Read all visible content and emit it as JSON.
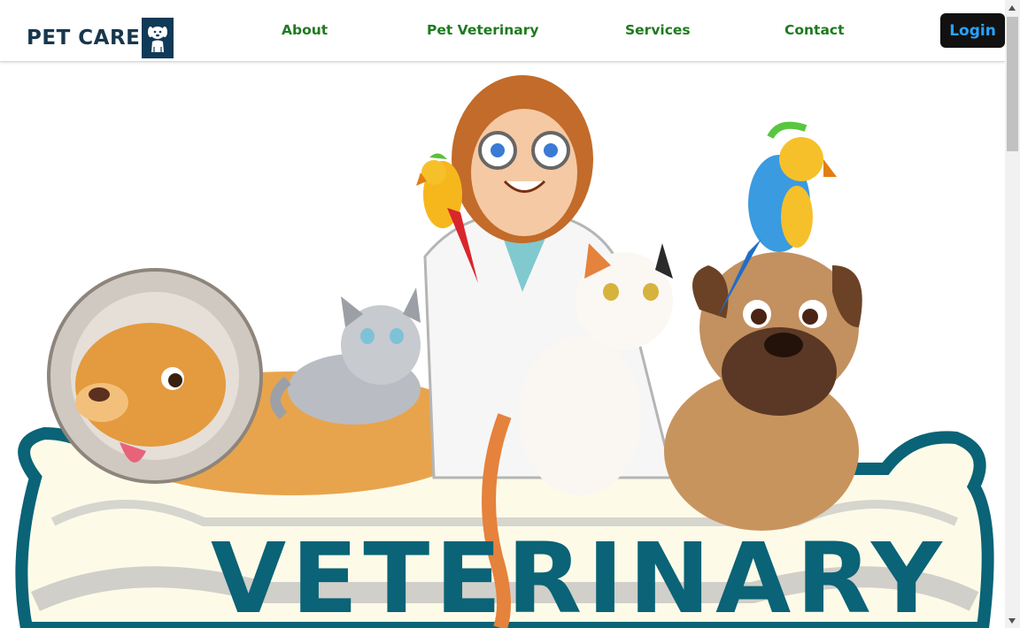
{
  "brand": {
    "name": "PET CARE",
    "logo_icon": "dog-icon"
  },
  "nav": {
    "items": [
      {
        "label": "About"
      },
      {
        "label": "Pet Veterinary"
      },
      {
        "label": "Services"
      },
      {
        "label": "Contact"
      }
    ],
    "login_label": "Login"
  },
  "hero": {
    "banner_text": "VETERINARY",
    "illustration": "veterinarian-with-pets"
  },
  "colors": {
    "nav_link": "#1f7a1f",
    "brand_text": "#17374d",
    "login_bg": "#111111",
    "login_text": "#29a3ff",
    "banner_teal": "#0a6376"
  }
}
